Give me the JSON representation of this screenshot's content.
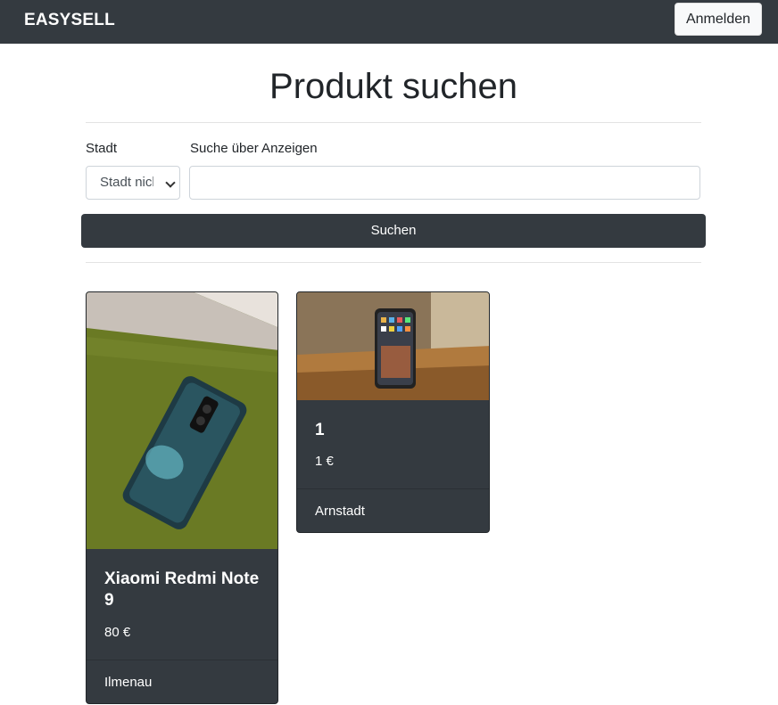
{
  "navbar": {
    "brand": "EASYSELL",
    "login_label": "Anmelden"
  },
  "main": {
    "title": "Produkt suchen",
    "city_label": "Stadt",
    "city_selected": "Stadt nicht",
    "search_label": "Suche über Anzeigen",
    "search_value": "",
    "search_button": "Suchen"
  },
  "cards": [
    {
      "title": "Xiaomi Redmi Note 9",
      "price": "80 €",
      "city": "Ilmenau",
      "image": "phone-photo"
    },
    {
      "title": "1",
      "price": "1 €",
      "city": "Arnstadt",
      "image": "iphone-photo"
    }
  ],
  "colors": {
    "dark": "#343a40",
    "light_btn": "#f8f9fa"
  }
}
